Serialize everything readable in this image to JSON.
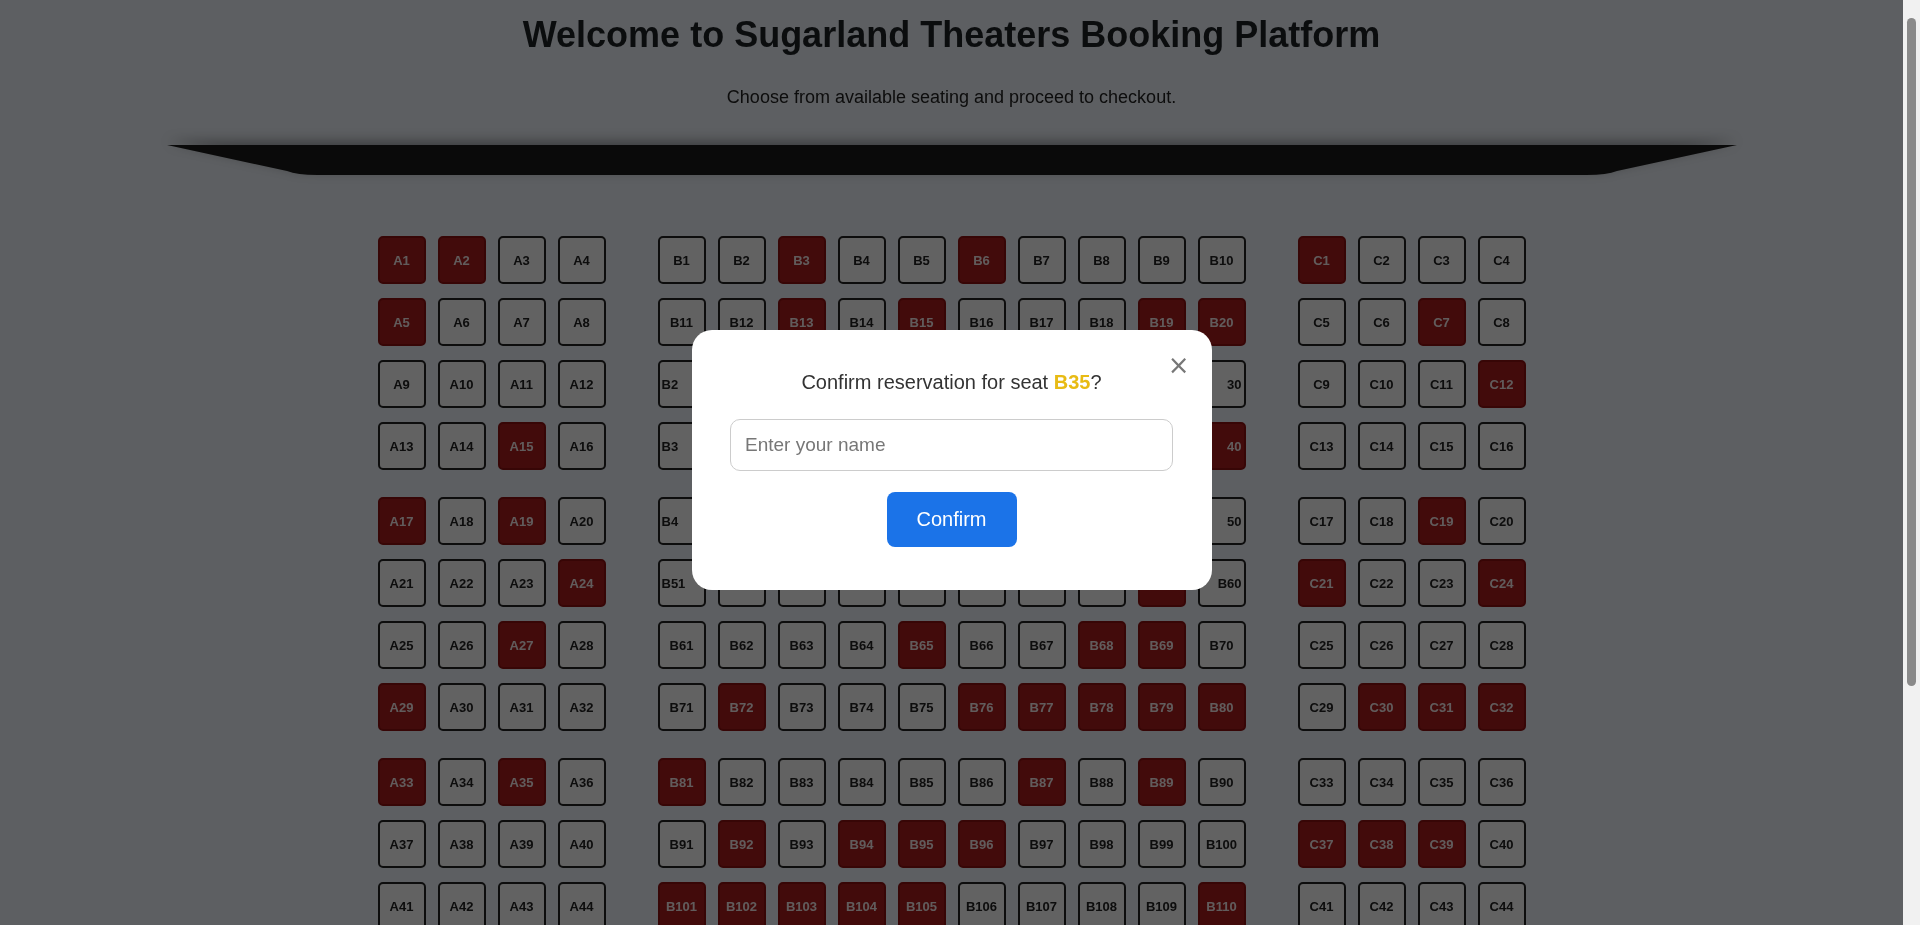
{
  "header": {
    "title": "Welcome to Sugarland Theaters Booking Platform",
    "subtitle": "Choose from available seating and proceed to checkout."
  },
  "seat_blocks": [
    {
      "row_groups": [
        {
          "rows": [
            {
              "seats": [
                {
                  "label": "A1",
                  "booked": true
                },
                {
                  "label": "A2",
                  "booked": true
                },
                {
                  "label": "A3",
                  "booked": false
                },
                {
                  "label": "A4",
                  "booked": false
                }
              ]
            },
            {
              "seats": [
                {
                  "label": "A5",
                  "booked": true
                },
                {
                  "label": "A6",
                  "booked": false
                },
                {
                  "label": "A7",
                  "booked": false
                },
                {
                  "label": "A8",
                  "booked": false
                }
              ]
            },
            {
              "seats": [
                {
                  "label": "A9",
                  "booked": false
                },
                {
                  "label": "A10",
                  "booked": false
                },
                {
                  "label": "A11",
                  "booked": false
                },
                {
                  "label": "A12",
                  "booked": false
                }
              ]
            },
            {
              "seats": [
                {
                  "label": "A13",
                  "booked": false
                },
                {
                  "label": "A14",
                  "booked": false
                },
                {
                  "label": "A15",
                  "booked": true
                },
                {
                  "label": "A16",
                  "booked": false
                }
              ]
            }
          ]
        },
        {
          "rows": [
            {
              "seats": [
                {
                  "label": "A17",
                  "booked": true
                },
                {
                  "label": "A18",
                  "booked": false
                },
                {
                  "label": "A19",
                  "booked": true
                },
                {
                  "label": "A20",
                  "booked": false
                }
              ]
            },
            {
              "seats": [
                {
                  "label": "A21",
                  "booked": false
                },
                {
                  "label": "A22",
                  "booked": false
                },
                {
                  "label": "A23",
                  "booked": false
                },
                {
                  "label": "A24",
                  "booked": true
                }
              ]
            },
            {
              "seats": [
                {
                  "label": "A25",
                  "booked": false
                },
                {
                  "label": "A26",
                  "booked": false
                },
                {
                  "label": "A27",
                  "booked": true
                },
                {
                  "label": "A28",
                  "booked": false
                }
              ]
            },
            {
              "seats": [
                {
                  "label": "A29",
                  "booked": true
                },
                {
                  "label": "A30",
                  "booked": false
                },
                {
                  "label": "A31",
                  "booked": false
                },
                {
                  "label": "A32",
                  "booked": false
                }
              ]
            }
          ]
        },
        {
          "rows": [
            {
              "seats": [
                {
                  "label": "A33",
                  "booked": true
                },
                {
                  "label": "A34",
                  "booked": false
                },
                {
                  "label": "A35",
                  "booked": true
                },
                {
                  "label": "A36",
                  "booked": false
                }
              ]
            },
            {
              "seats": [
                {
                  "label": "A37",
                  "booked": false
                },
                {
                  "label": "A38",
                  "booked": false
                },
                {
                  "label": "A39",
                  "booked": false
                },
                {
                  "label": "A40",
                  "booked": false
                }
              ]
            },
            {
              "seats": [
                {
                  "label": "A41",
                  "booked": false
                },
                {
                  "label": "A42",
                  "booked": false
                },
                {
                  "label": "A43",
                  "booked": false
                },
                {
                  "label": "A44",
                  "booked": false
                }
              ]
            }
          ]
        }
      ]
    },
    {
      "row_groups": [
        {
          "rows": [
            {
              "seats": [
                {
                  "label": "B1",
                  "booked": false
                },
                {
                  "label": "B2",
                  "booked": false
                },
                {
                  "label": "B3",
                  "booked": true
                },
                {
                  "label": "B4",
                  "booked": false
                },
                {
                  "label": "B5",
                  "booked": false
                },
                {
                  "label": "B6",
                  "booked": true
                },
                {
                  "label": "B7",
                  "booked": false
                },
                {
                  "label": "B8",
                  "booked": false
                },
                {
                  "label": "B9",
                  "booked": false
                },
                {
                  "label": "B10",
                  "booked": false
                }
              ]
            },
            {
              "seats": [
                {
                  "label": "B11",
                  "booked": false
                },
                {
                  "label": "B12",
                  "booked": false
                },
                {
                  "label": "B13",
                  "booked": true
                },
                {
                  "label": "B14",
                  "booked": false
                },
                {
                  "label": "B15",
                  "booked": true
                },
                {
                  "label": "B16",
                  "booked": false
                },
                {
                  "label": "B17",
                  "booked": false
                },
                {
                  "label": "B18",
                  "booked": false
                },
                {
                  "label": "B19",
                  "booked": true
                },
                {
                  "label": "B20",
                  "booked": true
                }
              ]
            },
            {
              "seats": [
                {
                  "label": "B2",
                  "booked": false
                },
                {
                  "label": "30",
                  "booked": false
                }
              ]
            },
            {
              "seats": [
                {
                  "label": "B3",
                  "booked": false
                },
                {
                  "label": "40",
                  "booked": true
                }
              ]
            }
          ]
        },
        {
          "rows": [
            {
              "seats": [
                {
                  "label": "B4",
                  "booked": false
                },
                {
                  "label": "50",
                  "booked": false
                }
              ]
            },
            {
              "seats": [
                {
                  "label": "B51",
                  "booked": false
                },
                {
                  "booked": false
                },
                {
                  "booked": false
                },
                {
                  "booked": false
                },
                {
                  "booked": false
                },
                {
                  "booked": false
                },
                {
                  "booked": false
                },
                {
                  "booked": false
                },
                {
                  "booked": true
                },
                {
                  "label": "B60",
                  "booked": false
                }
              ]
            },
            {
              "seats": [
                {
                  "label": "B61",
                  "booked": false
                },
                {
                  "label": "B62",
                  "booked": false
                },
                {
                  "label": "B63",
                  "booked": false
                },
                {
                  "label": "B64",
                  "booked": false
                },
                {
                  "label": "B65",
                  "booked": true
                },
                {
                  "label": "B66",
                  "booked": false
                },
                {
                  "label": "B67",
                  "booked": false
                },
                {
                  "label": "B68",
                  "booked": true
                },
                {
                  "label": "B69",
                  "booked": true
                },
                {
                  "label": "B70",
                  "booked": false
                }
              ]
            },
            {
              "seats": [
                {
                  "label": "B71",
                  "booked": false
                },
                {
                  "label": "B72",
                  "booked": true
                },
                {
                  "label": "B73",
                  "booked": false
                },
                {
                  "label": "B74",
                  "booked": false
                },
                {
                  "label": "B75",
                  "booked": false
                },
                {
                  "label": "B76",
                  "booked": true
                },
                {
                  "label": "B77",
                  "booked": true
                },
                {
                  "label": "B78",
                  "booked": true
                },
                {
                  "label": "B79",
                  "booked": true
                },
                {
                  "label": "B80",
                  "booked": true
                }
              ]
            }
          ]
        },
        {
          "rows": [
            {
              "seats": [
                {
                  "label": "B81",
                  "booked": true
                },
                {
                  "label": "B82",
                  "booked": false
                },
                {
                  "label": "B83",
                  "booked": false
                },
                {
                  "label": "B84",
                  "booked": false
                },
                {
                  "label": "B85",
                  "booked": false
                },
                {
                  "label": "B86",
                  "booked": false
                },
                {
                  "label": "B87",
                  "booked": true
                },
                {
                  "label": "B88",
                  "booked": false
                },
                {
                  "label": "B89",
                  "booked": true
                },
                {
                  "label": "B90",
                  "booked": false
                }
              ]
            },
            {
              "seats": [
                {
                  "label": "B91",
                  "booked": false
                },
                {
                  "label": "B92",
                  "booked": true
                },
                {
                  "label": "B93",
                  "booked": false
                },
                {
                  "label": "B94",
                  "booked": true
                },
                {
                  "label": "B95",
                  "booked": true
                },
                {
                  "label": "B96",
                  "booked": true
                },
                {
                  "label": "B97",
                  "booked": false
                },
                {
                  "label": "B98",
                  "booked": false
                },
                {
                  "label": "B99",
                  "booked": false
                },
                {
                  "label": "B100",
                  "booked": false
                }
              ]
            },
            {
              "seats": [
                {
                  "label": "B101",
                  "booked": true
                },
                {
                  "label": "B102",
                  "booked": true
                },
                {
                  "label": "B103",
                  "booked": true
                },
                {
                  "label": "B104",
                  "booked": true
                },
                {
                  "label": "B105",
                  "booked": true
                },
                {
                  "label": "B106",
                  "booked": false
                },
                {
                  "label": "B107",
                  "booked": false
                },
                {
                  "label": "B108",
                  "booked": false
                },
                {
                  "label": "B109",
                  "booked": false
                },
                {
                  "label": "B110",
                  "booked": true
                }
              ]
            }
          ]
        }
      ]
    },
    {
      "row_groups": [
        {
          "rows": [
            {
              "seats": [
                {
                  "label": "C1",
                  "booked": true
                },
                {
                  "label": "C2",
                  "booked": false
                },
                {
                  "label": "C3",
                  "booked": false
                },
                {
                  "label": "C4",
                  "booked": false
                }
              ]
            },
            {
              "seats": [
                {
                  "label": "C5",
                  "booked": false
                },
                {
                  "label": "C6",
                  "booked": false
                },
                {
                  "label": "C7",
                  "booked": true
                },
                {
                  "label": "C8",
                  "booked": false
                }
              ]
            },
            {
              "seats": [
                {
                  "label": "C9",
                  "booked": false
                },
                {
                  "label": "C10",
                  "booked": false
                },
                {
                  "label": "C11",
                  "booked": false
                },
                {
                  "label": "C12",
                  "booked": true
                }
              ]
            },
            {
              "seats": [
                {
                  "label": "C13",
                  "booked": false
                },
                {
                  "label": "C14",
                  "booked": false
                },
                {
                  "label": "C15",
                  "booked": false
                },
                {
                  "label": "C16",
                  "booked": false
                }
              ]
            }
          ]
        },
        {
          "rows": [
            {
              "seats": [
                {
                  "label": "C17",
                  "booked": false
                },
                {
                  "label": "C18",
                  "booked": false
                },
                {
                  "label": "C19",
                  "booked": true
                },
                {
                  "label": "C20",
                  "booked": false
                }
              ]
            },
            {
              "seats": [
                {
                  "label": "C21",
                  "booked": true
                },
                {
                  "label": "C22",
                  "booked": false
                },
                {
                  "label": "C23",
                  "booked": false
                },
                {
                  "label": "C24",
                  "booked": true
                }
              ]
            },
            {
              "seats": [
                {
                  "label": "C25",
                  "booked": false
                },
                {
                  "label": "C26",
                  "booked": false
                },
                {
                  "label": "C27",
                  "booked": false
                },
                {
                  "label": "C28",
                  "booked": false
                }
              ]
            },
            {
              "seats": [
                {
                  "label": "C29",
                  "booked": false
                },
                {
                  "label": "C30",
                  "booked": true
                },
                {
                  "label": "C31",
                  "booked": true
                },
                {
                  "label": "C32",
                  "booked": true
                }
              ]
            }
          ]
        },
        {
          "rows": [
            {
              "seats": [
                {
                  "label": "C33",
                  "booked": false
                },
                {
                  "label": "C34",
                  "booked": false
                },
                {
                  "label": "C35",
                  "booked": false
                },
                {
                  "label": "C36",
                  "booked": false
                }
              ]
            },
            {
              "seats": [
                {
                  "label": "C37",
                  "booked": true
                },
                {
                  "label": "C38",
                  "booked": true
                },
                {
                  "label": "C39",
                  "booked": true
                },
                {
                  "label": "C40",
                  "booked": false
                }
              ]
            },
            {
              "seats": [
                {
                  "label": "C41",
                  "booked": false
                },
                {
                  "label": "C42",
                  "booked": false
                },
                {
                  "label": "C43",
                  "booked": false
                },
                {
                  "label": "C44",
                  "booked": false
                }
              ]
            }
          ]
        }
      ]
    }
  ],
  "modal": {
    "close": "×",
    "title": "Confirm reservation for seat **B35**?",
    "name_field": {
      "placeholder": "Enter your name"
    },
    "confirm_button": "Confirm"
  }
}
